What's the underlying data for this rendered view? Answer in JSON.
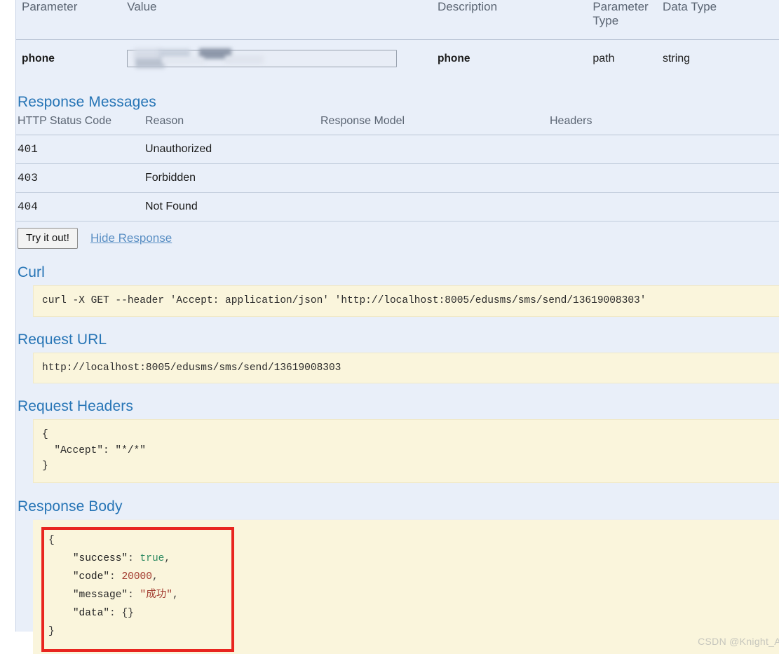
{
  "parameters": {
    "columns": [
      "Parameter",
      "Value",
      "Description",
      "Parameter Type",
      "Data Type"
    ],
    "column_ptype_line1": "Parameter",
    "column_ptype_line2": "Type",
    "rows": [
      {
        "name": "phone",
        "value": "",
        "value_placeholder": "",
        "value_redacted": true,
        "description": "phone",
        "parameter_type": "path",
        "data_type": "string"
      }
    ]
  },
  "response_messages": {
    "title": "Response Messages",
    "columns": [
      "HTTP Status Code",
      "Reason",
      "Response Model",
      "Headers"
    ],
    "rows": [
      {
        "code": "401",
        "reason": "Unauthorized",
        "model": "",
        "headers": ""
      },
      {
        "code": "403",
        "reason": "Forbidden",
        "model": "",
        "headers": ""
      },
      {
        "code": "404",
        "reason": "Not Found",
        "model": "",
        "headers": ""
      }
    ]
  },
  "actions": {
    "try_it_out": "Try it out!",
    "hide_response": "Hide Response"
  },
  "curl": {
    "title": "Curl",
    "command": "curl -X GET --header 'Accept: application/json' 'http://localhost:8005/edusms/sms/send/13619008303'"
  },
  "request_url": {
    "title": "Request URL",
    "url": "http://localhost:8005/edusms/sms/send/13619008303"
  },
  "request_headers": {
    "title": "Request Headers",
    "body": "{\n  \"Accept\": \"*/*\"\n}"
  },
  "response_body": {
    "title": "Response Body",
    "lines": {
      "open": "{",
      "success_key": "\"success\"",
      "success_val": "true",
      "code_key": "\"code\"",
      "code_val": "20000",
      "message_key": "\"message\"",
      "message_val": "\"成功\"",
      "data_key": "\"data\"",
      "data_val": "{}",
      "close": "}"
    },
    "raw": "{\n    \"success\": true,\n    \"code\": 20000,\n    \"message\": \"成功\",\n    \"data\": {}\n}"
  },
  "annotation": {
    "highlight_color": "#e8251f"
  },
  "watermark": "CSDN @Knight_AL",
  "colors": {
    "page_background": "#e9eff9",
    "code_background": "#faf5dc",
    "heading": "#2775b6",
    "link": "#5a8fc4",
    "bool_token": "#2e8b62",
    "number_token": "#a23a2e",
    "string_token": "#a23a2e"
  }
}
